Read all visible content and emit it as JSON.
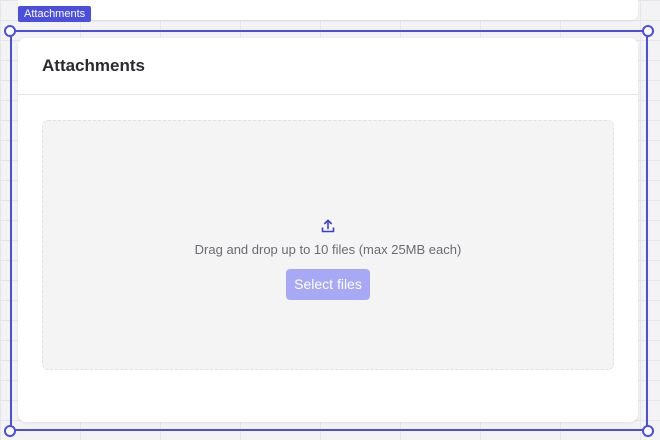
{
  "selection": {
    "label": "Attachments"
  },
  "panel": {
    "title": "Attachments"
  },
  "dropzone": {
    "instruction": "Drag and drop up to 10 files (max 25MB each)",
    "button_label": "Select files",
    "icon": "upload-icon"
  },
  "colors": {
    "selection_accent": "#4b4fe0",
    "button_background": "#a8a9f5",
    "icon_color": "#3b3fc8"
  }
}
